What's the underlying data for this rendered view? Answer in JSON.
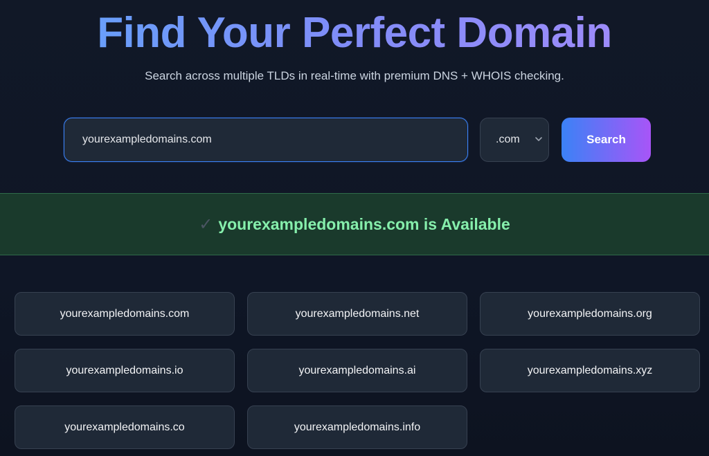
{
  "header": {
    "title": "Find Your Perfect Domain",
    "subtitle": "Search across multiple TLDs in real-time with premium DNS + WHOIS checking."
  },
  "search": {
    "value": "yourexampledomains.com",
    "tld_selected": ".com",
    "button_label": "Search"
  },
  "result": {
    "check_glyph": "✓",
    "message": "yourexampledomains.com is Available"
  },
  "suggestions": [
    "yourexampledomains.com",
    "yourexampledomains.net",
    "yourexampledomains.org",
    "yourexampledomains.io",
    "yourexampledomains.ai",
    "yourexampledomains.xyz",
    "yourexampledomains.co",
    "yourexampledomains.info"
  ],
  "colors": {
    "accent_start": "#3b82f6",
    "accent_end": "#a855f7",
    "success": "#86efac"
  }
}
